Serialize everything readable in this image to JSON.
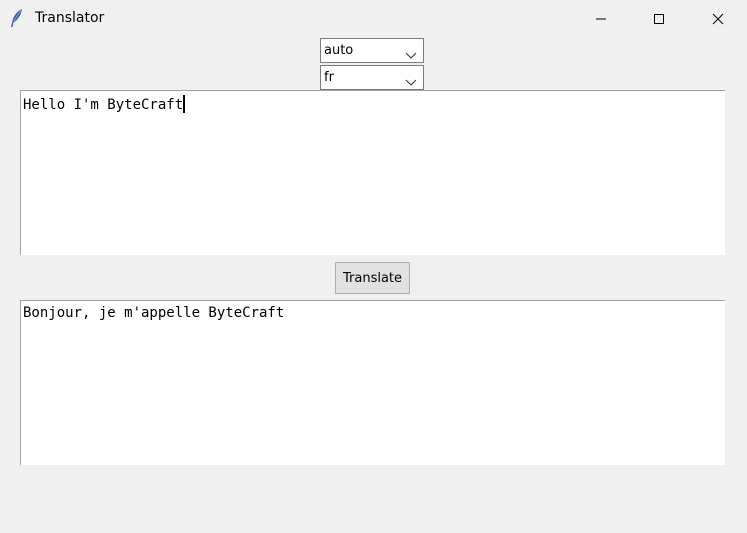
{
  "window": {
    "title": "Translator",
    "icon": "feather-icon",
    "controls": [
      "minimize-icon",
      "maximize-icon",
      "close-icon"
    ]
  },
  "source_language": {
    "selected": "auto"
  },
  "target_language": {
    "selected": "fr"
  },
  "input_text": {
    "value": "Hello I'm ByteCraft"
  },
  "translate_button": {
    "label": "Translate"
  },
  "output_text": {
    "value": "Bonjour, je m'appelle ByteCraft"
  }
}
